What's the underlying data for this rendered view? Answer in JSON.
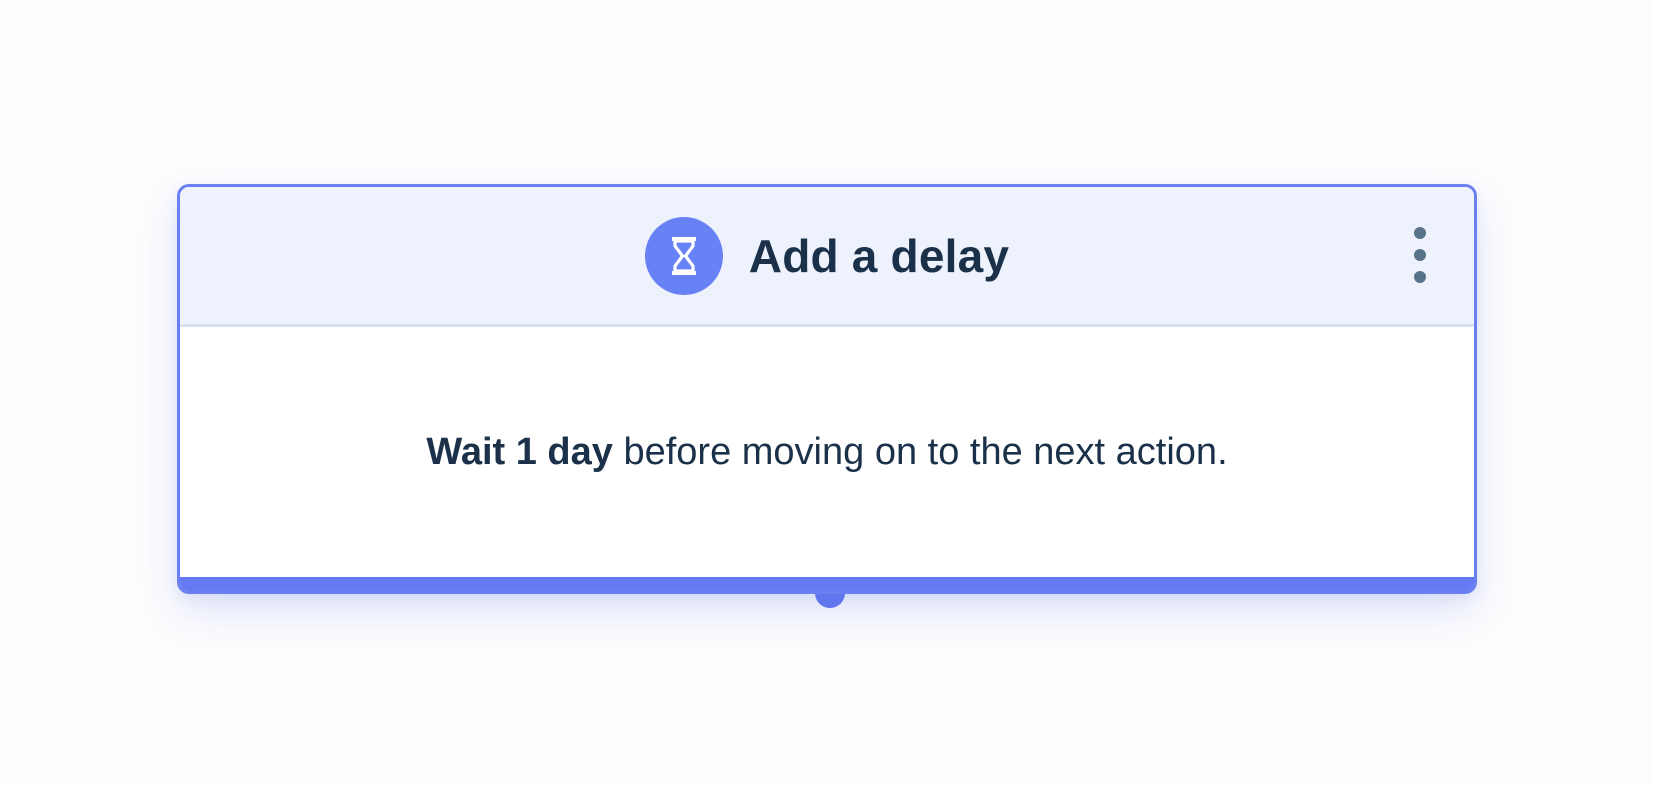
{
  "card": {
    "title": "Add a delay",
    "icon": "hourglass-icon",
    "menu_icon": "more-vertical-icon",
    "body": {
      "strong_text": "Wait 1 day",
      "rest_text": " before moving on to the next action."
    }
  },
  "colors": {
    "accent": "#6479f2",
    "header_bg": "#edf2fc",
    "text": "#1b3149",
    "menu_dots": "#587389"
  }
}
